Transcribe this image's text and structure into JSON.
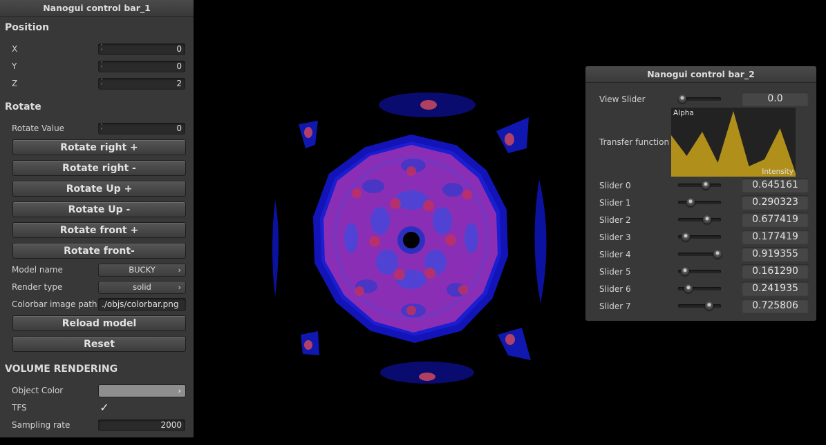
{
  "panel1": {
    "title": "Nanogui control bar_1",
    "position": {
      "heading": "Position",
      "x": {
        "label": "X",
        "value": "0"
      },
      "y": {
        "label": "Y",
        "value": "0"
      },
      "z": {
        "label": "Z",
        "value": "2"
      }
    },
    "rotate": {
      "heading": "Rotate",
      "value_label": "Rotate Value",
      "value": "0",
      "buttons": [
        "Rotate right +",
        "Rotate right -",
        "Rotate Up +",
        "Rotate Up -",
        "Rotate front +",
        "Rotate front-"
      ]
    },
    "model_name": {
      "label": "Model name",
      "value": "BUCKY"
    },
    "render_type": {
      "label": "Render type",
      "value": "solid"
    },
    "colorbar": {
      "label": "Colorbar image path",
      "value": "./objs/colorbar.png"
    },
    "reload_label": "Reload model",
    "reset_label": "Reset",
    "volume": {
      "heading": "VOLUME RENDERING",
      "object_color_label": "Object Color",
      "object_color": "#8e8e8e",
      "tfs_label": "TFS",
      "tfs_checked": true,
      "sampling_label": "Sampling rate",
      "sampling_value": "2000"
    }
  },
  "panel2": {
    "title": "Nanogui control bar_2",
    "view_slider": {
      "label": "View Slider",
      "value": "0.0",
      "position": 0.1
    },
    "transfer_function": {
      "label": "Transfer function",
      "y_label": "Alpha",
      "x_label": "Intensity",
      "fill_color": "#b0901a",
      "points": [
        0.6,
        0.3,
        0.65,
        0.2,
        0.95,
        0.15,
        0.25,
        0.7,
        0.05
      ]
    },
    "sliders": [
      {
        "label": "Slider 0",
        "value": "0.645161",
        "position": 0.645161
      },
      {
        "label": "Slider 1",
        "value": "0.290323",
        "position": 0.290323
      },
      {
        "label": "Slider 2",
        "value": "0.677419",
        "position": 0.677419
      },
      {
        "label": "Slider 3",
        "value": "0.177419",
        "position": 0.177419
      },
      {
        "label": "Slider 4",
        "value": "0.919355",
        "position": 0.919355
      },
      {
        "label": "Slider 5",
        "value": "0.161290",
        "position": 0.16129
      },
      {
        "label": "Slider 6",
        "value": "0.241935",
        "position": 0.241935
      },
      {
        "label": "Slider 7",
        "value": "0.725806",
        "position": 0.725806
      }
    ]
  }
}
